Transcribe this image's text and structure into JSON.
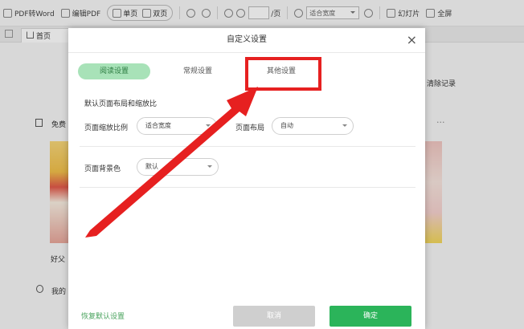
{
  "toolbar": {
    "pdf_to_word": "PDF转Word",
    "edit_pdf": "编辑PDF",
    "single_page": "单页",
    "double_page": "双页",
    "page_suffix": "/页",
    "zoom_value": "适合宽度",
    "slideshow": "幻灯片",
    "fullscreen": "全屏"
  },
  "tabs": {
    "home": "首页"
  },
  "background": {
    "free_label": "免费",
    "clear_records": "清除记录",
    "book_caption": "好父",
    "mine_label": "我的",
    "more": "···"
  },
  "dialog": {
    "title": "自定义设置",
    "tabs": [
      {
        "label": "阅读设置",
        "active": true
      },
      {
        "label": "常规设置",
        "active": false
      },
      {
        "label": "其他设置",
        "active": false
      }
    ],
    "section_title": "默认页面布局和缩放比",
    "zoom_label": "页面缩放比例",
    "zoom_value": "适合宽度",
    "layout_label": "页面布局",
    "layout_value": "自动",
    "bg_label": "页面背景色",
    "bg_value": "默认",
    "reset_link": "恢复默认设置",
    "cancel_button": "取消",
    "ok_button": "确定"
  },
  "colors": {
    "accent_green": "#2bb45a",
    "active_tab_bg": "#a8e2b8",
    "highlight_red": "#e62020"
  }
}
